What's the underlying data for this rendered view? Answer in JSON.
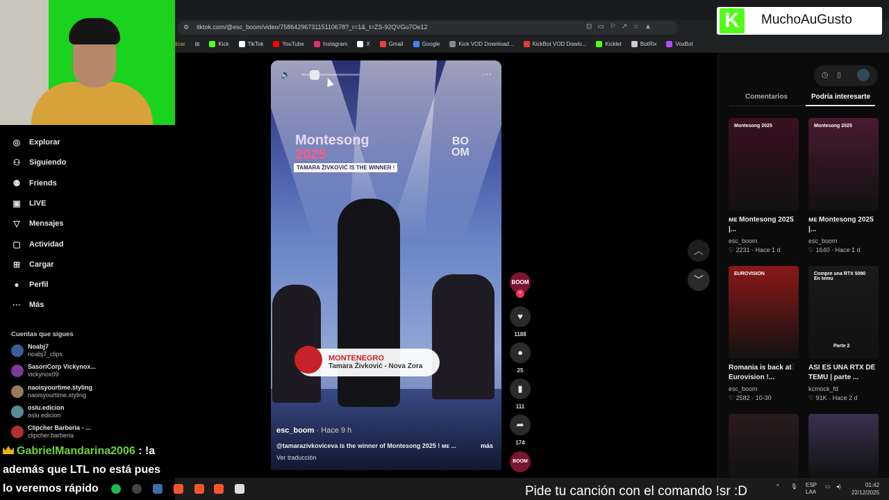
{
  "browser": {
    "url": "tiktok.com/@esc_boom/video/7586429673115110678?_r=1&_t=ZS-92QVGu7Oe12",
    "bookmark_partial": "licar",
    "bookmarks": [
      {
        "label": "Kick",
        "color": "#53fc18"
      },
      {
        "label": "TikTok",
        "color": "#ffffff"
      },
      {
        "label": "YouTube",
        "color": "#ff0000"
      },
      {
        "label": "Instagram",
        "color": "#e1306c"
      },
      {
        "label": "X",
        "color": "#ffffff"
      },
      {
        "label": "Gmail",
        "color": "#ea4335"
      },
      {
        "label": "Google",
        "color": "#4285f4"
      },
      {
        "label": "Kick VOD Download...",
        "color": "#888888"
      },
      {
        "label": "KickBot VOD Dowlo...",
        "color": "#e33b3b"
      },
      {
        "label": "Kicklet",
        "color": "#53fc18"
      },
      {
        "label": "BotRix",
        "color": "#cccccc"
      },
      {
        "label": "VoxBot",
        "color": "#b14cff"
      }
    ]
  },
  "overlay_logo": {
    "letter": "K",
    "text": "MuchoAuGusto"
  },
  "sidebar": {
    "items": [
      {
        "label": "Explorar",
        "icon": "compass-icon",
        "glyph": "◎"
      },
      {
        "label": "Siguiendo",
        "icon": "user-follow-icon",
        "glyph": "⚇"
      },
      {
        "label": "Friends",
        "icon": "friends-icon",
        "glyph": "⚉"
      },
      {
        "label": "LIVE",
        "icon": "live-icon",
        "glyph": "▣"
      },
      {
        "label": "Mensajes",
        "icon": "messages-icon",
        "glyph": "▽"
      },
      {
        "label": "Actividad",
        "icon": "activity-icon",
        "glyph": "▢"
      },
      {
        "label": "Cargar",
        "icon": "upload-icon",
        "glyph": "⊞"
      },
      {
        "label": "Perfil",
        "icon": "profile-icon",
        "glyph": "●"
      },
      {
        "label": "Más",
        "icon": "more-icon",
        "glyph": "···"
      }
    ],
    "following_title": "Cuentas que sigues",
    "accounts": [
      {
        "name": "Noabj7",
        "handle": "noabj7_clips",
        "color": "#3a5f9a"
      },
      {
        "name": "SasoriCorp Vickynox...",
        "handle": "vickynox09",
        "color": "#7a3a9a"
      },
      {
        "name": "naoisyourtime.styling",
        "handle": "naoisyourtime.styling",
        "color": "#9a7a5a"
      },
      {
        "name": "oslu.edicion",
        "handle": "oslu.edicion",
        "color": "#5a8a9a"
      },
      {
        "name": "Clipcher Barberia - ...",
        "handle": "clipcher.barberia",
        "color": "#b03030"
      }
    ]
  },
  "chat": {
    "username": "GabrielMandarina2006",
    "line1_rest": ": !a",
    "line2": "además que LTL no está pues",
    "line3": "lo veremos rápido"
  },
  "video": {
    "title_line1": "Montesong",
    "title_year": "2025",
    "winner_banner": "TAMARA ŽIVKOVIĆ IS THE WINNER !",
    "brand_line1": "BO",
    "brand_line2": "OM",
    "country": "MONTENEGRO",
    "song": "Tamara Živković - Nova Zora",
    "volume_level": 0.2,
    "author": "esc_boom",
    "time": "· Hace 9 h",
    "description": "@tamarazivkoviceva is the winner of Montesong 2025 ! ᴍᴇ ...",
    "more_label": "más",
    "translate_label": "Ver traducción"
  },
  "actions": {
    "avatar_text": "BOOM",
    "likes": "1188",
    "comments": "25",
    "saves": "111",
    "shares": "174"
  },
  "right_panel": {
    "tabs": [
      "Comentarios",
      "Podría interesarte"
    ],
    "active_tab": 1,
    "cards": [
      {
        "title": "ᴍᴇ Montesong 2025 |...",
        "user": "esc_boom",
        "meta": "♡ 2231 · Hace 1 d",
        "thumb_title": "Montesong 2025",
        "bg": "#3a1020",
        "caption": ""
      },
      {
        "title": "ᴍᴇ Montesong 2025 |...",
        "user": "esc_boom",
        "meta": "♡ 1640 · Hace 1 d",
        "thumb_title": "Montesong 2025",
        "bg": "#4a1a30",
        "caption": ""
      },
      {
        "title": "Romania is back at Eurovision !...",
        "user": "esc_boom",
        "meta": "♡ 2582 · 10-30",
        "thumb_title": "EUROVISION",
        "bg": "#8a1818",
        "caption": ""
      },
      {
        "title": "ASI ES UNA RTX DE TEMU | parte ...",
        "user": "kcmock_fd",
        "meta": "♡ 91K · Hace 2 d",
        "thumb_title": "Compre una RTX 5090 En temu",
        "bg": "#1a1a1a",
        "caption": "Parte 2"
      },
      {
        "title": "",
        "user": "",
        "meta": "",
        "thumb_title": "",
        "bg": "#2a1a1e",
        "caption": ""
      },
      {
        "title": "",
        "user": "",
        "meta": "",
        "thumb_title": "",
        "bg": "#3a3050",
        "caption": ""
      }
    ]
  },
  "taskbar": {
    "song_request": "Pide tu canción con el comando !sr :D",
    "lang1": "ESP",
    "lang2": "LAA",
    "time": "01:42",
    "date": "22/12/2025"
  }
}
